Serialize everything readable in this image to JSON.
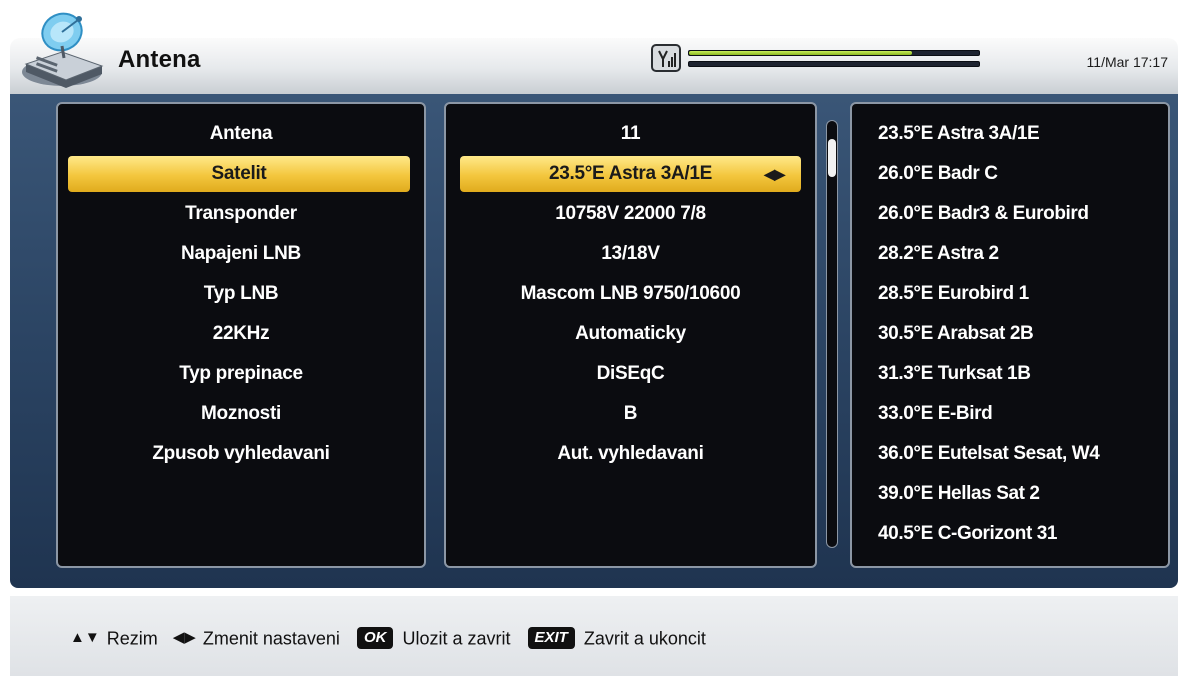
{
  "header": {
    "title": "Antena",
    "datetime": "11/Mar 17:17",
    "signal_icon": "signal-tower-icon",
    "signal_strength": 0.77,
    "signal_quality": 0.0
  },
  "settings": {
    "labels": [
      "Antena",
      "Satelit",
      "Transponder",
      "Napajeni LNB",
      "Typ LNB",
      "22KHz",
      "Typ prepinace",
      "Moznosti",
      "Zpusob vyhledavani"
    ],
    "values": [
      "11",
      "23.5°E Astra 3A/1E",
      "10758V 22000 7/8",
      "13/18V",
      "Mascom LNB 9750/10600",
      "Automaticky",
      "DiSEqC",
      "B",
      "Aut. vyhledavani"
    ],
    "selected_index": 1,
    "selected_arrows": "◆"
  },
  "satellites": [
    "23.5°E Astra 3A/1E",
    "26.0°E Badr C",
    "26.0°E Badr3 & Eurobird",
    "28.2°E Astra 2",
    "28.5°E Eurobird 1",
    "30.5°E Arabsat 2B",
    "31.3°E Turksat 1B",
    "33.0°E E-Bird",
    "36.0°E Eutelsat Sesat, W4",
    "39.0°E Hellas Sat 2",
    "40.5°E C-Gorizont 31"
  ],
  "footer": {
    "mode_label": "Rezim",
    "change_label": "Zmenit nastaveni",
    "ok_key": "OK",
    "ok_label": "Ulozit a zavrit",
    "exit_key": "EXIT",
    "exit_label": "Zavrit a ukoncit"
  },
  "colors": {
    "selection": "#f3c63d",
    "panel_bg": "#0b0c10",
    "frame_bg": "#2b4463",
    "signal_strength_bar": "#a3d12e"
  }
}
